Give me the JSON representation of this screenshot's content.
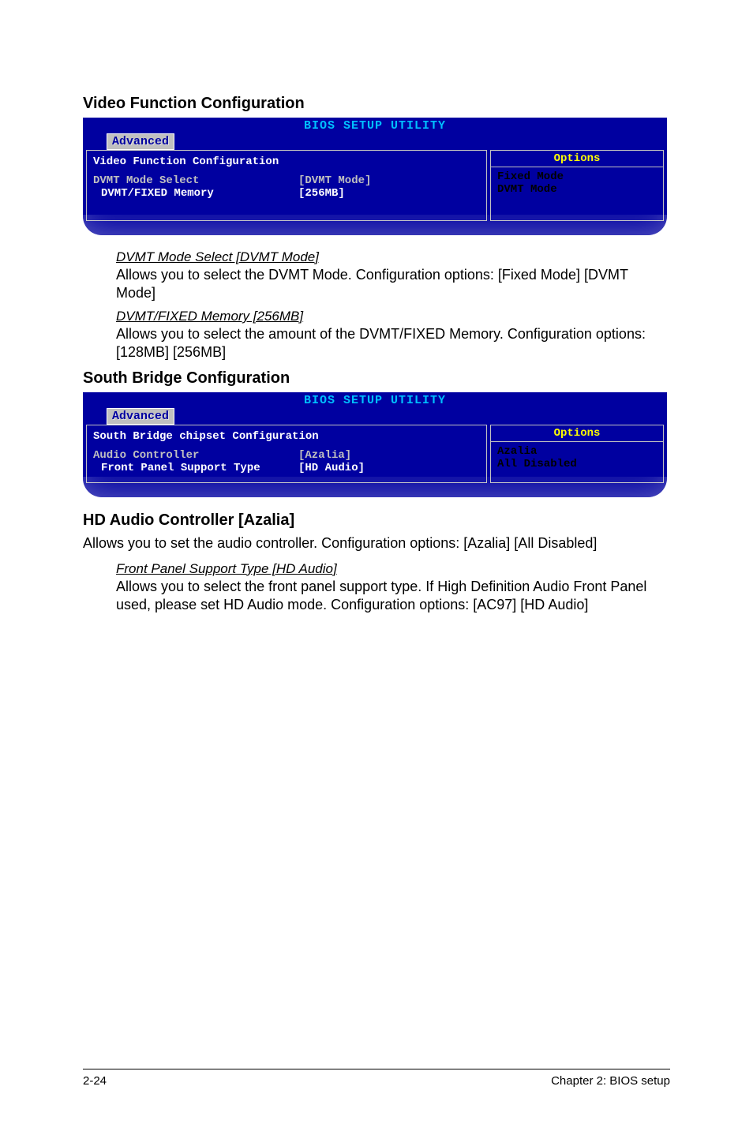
{
  "headings": {
    "video_func": "Video Function Configuration",
    "south_bridge": "South Bridge Configuration",
    "hd_audio": "HD Audio Controller [Azalia]"
  },
  "bios1": {
    "title": "BIOS SETUP UTILITY",
    "tab": "Advanced",
    "panel_header": "Video Function Configuration",
    "row1_label": "DVMT Mode Select",
    "row1_val": "[DVMT Mode]",
    "row2_label": "DVMT/FIXED Memory",
    "row2_val": "[256MB]",
    "options_header": "Options",
    "opt1": "Fixed Mode",
    "opt2": "DVMT Mode"
  },
  "desc1": {
    "title": "DVMT Mode Select [DVMT Mode]",
    "text": "Allows you to select the DVMT Mode. Configuration options: [Fixed Mode] [DVMT Mode]"
  },
  "desc2": {
    "title": "DVMT/FIXED Memory [256MB]",
    "text": "Allows you to select the amount of the DVMT/FIXED Memory. Configuration options: [128MB] [256MB]"
  },
  "bios2": {
    "title": "BIOS SETUP UTILITY",
    "tab": "Advanced",
    "panel_header": "South Bridge chipset Configuration",
    "row1_label": "Audio Controller",
    "row1_val": "[Azalia]",
    "row2_label": "Front Panel Support Type",
    "row2_val": "[HD Audio]",
    "options_header": "Options",
    "opt1": "Azalia",
    "opt2": "All Disabled"
  },
  "hd_audio_text": "Allows you to set the audio controller. Configuration options: [Azalia] [All Disabled]",
  "desc3": {
    "title": " Front Panel Support Type [HD Audio]",
    "text": "Allows you to select the front panel support type. If High Definition Audio Front Panel used, please set HD Audio mode. Configuration options: [AC97] [HD Audio]"
  },
  "footer": {
    "left": "2-24",
    "right": "Chapter 2: BIOS setup"
  }
}
